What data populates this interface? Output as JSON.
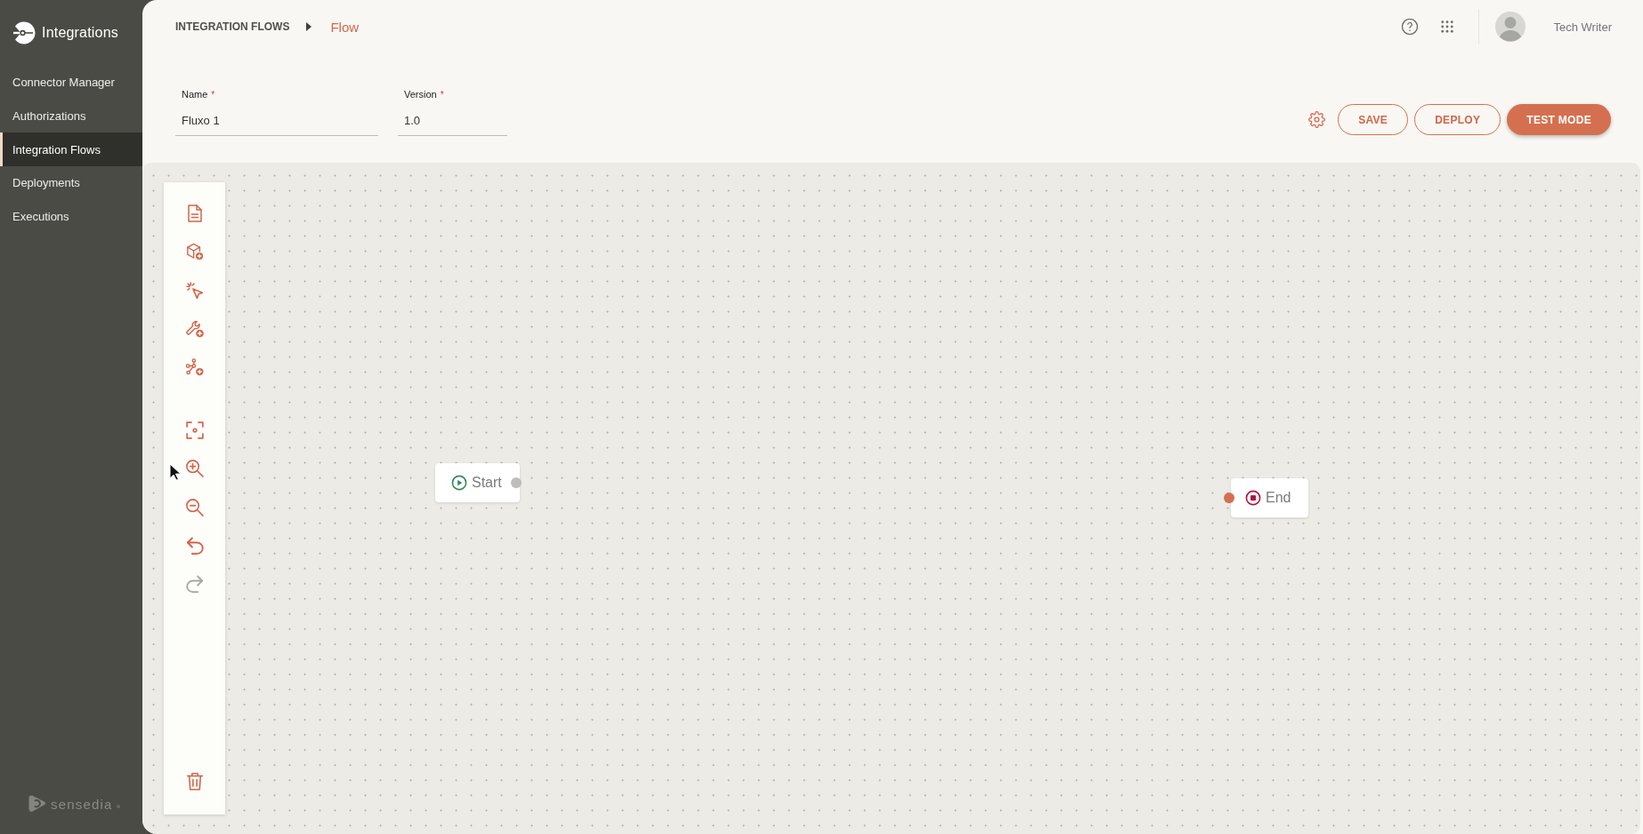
{
  "sidebar": {
    "brand": "Integrations",
    "items": [
      {
        "label": "Connector Manager",
        "selected": false
      },
      {
        "label": "Authorizations",
        "selected": false
      },
      {
        "label": "Integration Flows",
        "selected": true
      },
      {
        "label": "Deployments",
        "selected": false
      },
      {
        "label": "Executions",
        "selected": false
      }
    ],
    "footer_logo": "sensedia"
  },
  "header": {
    "breadcrumb": [
      {
        "label": "INTEGRATION FLOWS",
        "current": false
      },
      {
        "label": "Flow",
        "current": true
      }
    ],
    "user": {
      "name": "Tech Writer"
    }
  },
  "form": {
    "fields": [
      {
        "label": "Name",
        "required_mark": "*",
        "value": "Fluxo 1"
      },
      {
        "label": "Version",
        "required_mark": "*",
        "value": "1.0"
      }
    ],
    "buttons": [
      {
        "label": "SAVE",
        "kind": "outline"
      },
      {
        "label": "DEPLOY",
        "kind": "outline"
      },
      {
        "label": "TEST MODE",
        "kind": "filled"
      }
    ]
  },
  "toolbar": {
    "groups": [
      {
        "tools": [
          {
            "kind": "document",
            "disabled": false
          },
          {
            "kind": "cube",
            "disabled": false
          },
          {
            "kind": "click",
            "disabled": false
          },
          {
            "kind": "wrench",
            "disabled": false
          },
          {
            "kind": "network",
            "disabled": false
          }
        ]
      },
      {
        "tools": [
          {
            "kind": "focus",
            "disabled": false
          },
          {
            "kind": "zoomin",
            "disabled": false
          },
          {
            "kind": "zoomout",
            "disabled": false
          },
          {
            "kind": "undo",
            "disabled": false
          },
          {
            "kind": "redo",
            "disabled": true
          }
        ]
      },
      {
        "tools": [
          {
            "kind": "trash",
            "disabled": false
          }
        ]
      }
    ]
  },
  "canvas": {
    "nodes": [
      {
        "kind": "start",
        "label": "Start"
      },
      {
        "kind": "end",
        "label": "End"
      }
    ]
  }
}
